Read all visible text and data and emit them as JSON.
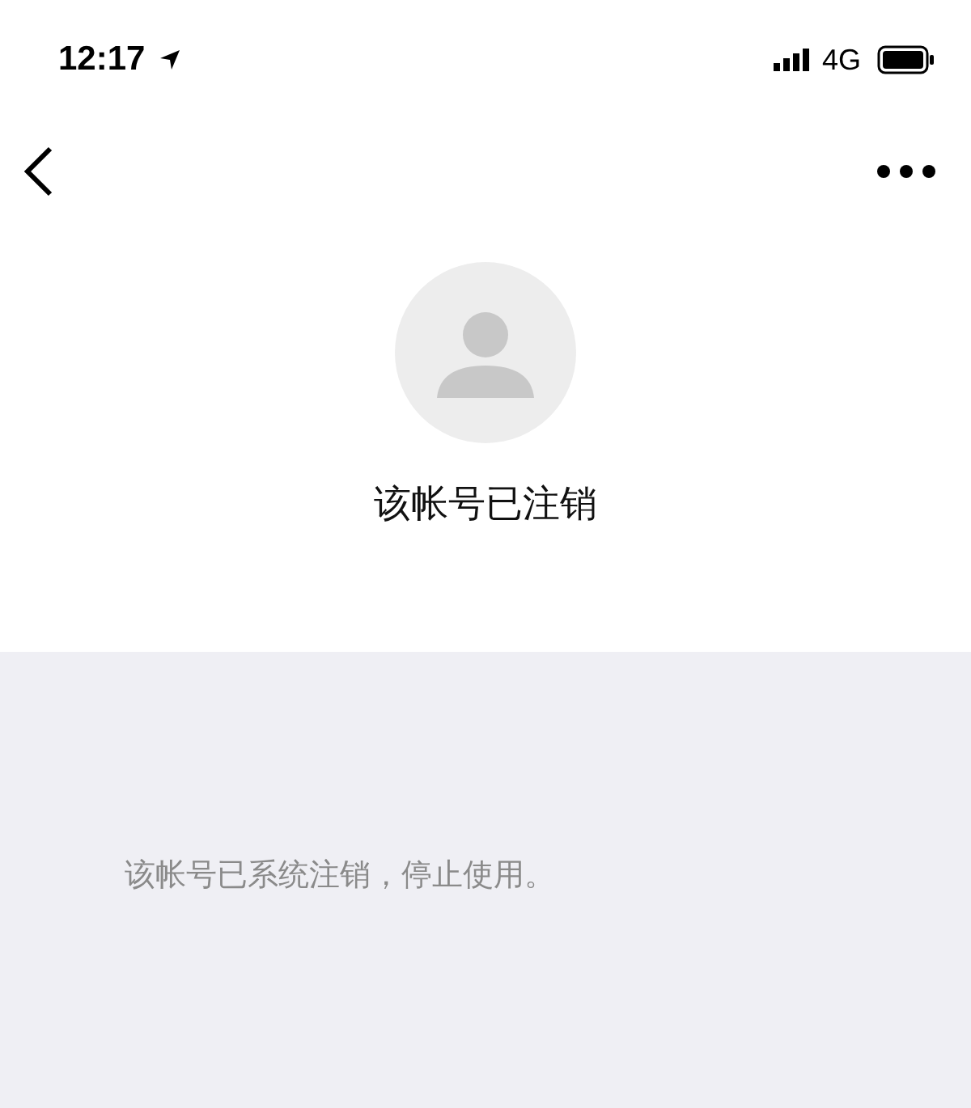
{
  "status_bar": {
    "time": "12:17",
    "network": "4G"
  },
  "profile": {
    "name": "该帐号已注销"
  },
  "notice": {
    "text": "该帐号已系统注销，停止使用。"
  }
}
